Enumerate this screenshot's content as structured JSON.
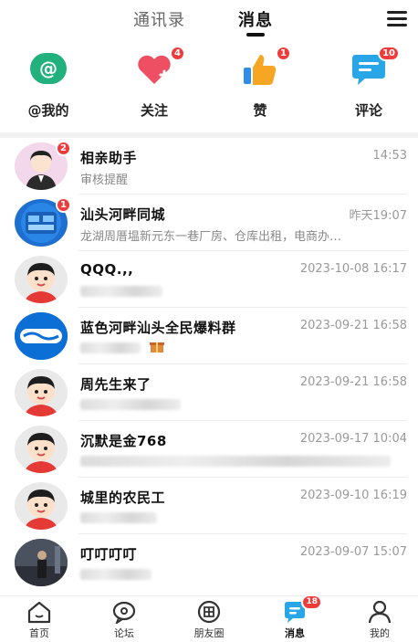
{
  "top_tabs": [
    {
      "label": "通讯录"
    },
    {
      "label": "消息"
    }
  ],
  "quick_actions": [
    {
      "label": "@我的",
      "icon": "at-icon",
      "badge": "",
      "color": "#22b07d"
    },
    {
      "label": "关注",
      "icon": "heart-plus-icon",
      "badge": "4",
      "color": "#ef4f63"
    },
    {
      "label": "赞",
      "icon": "thumbs-up-icon",
      "badge": "1",
      "color": "#f6a623"
    },
    {
      "label": "评论",
      "icon": "comment-icon",
      "badge": "10",
      "color": "#29a6e8"
    }
  ],
  "conversations": [
    {
      "name": "相亲助手",
      "time": "14:53",
      "preview": "审核提醒",
      "badge": "2",
      "avatar": "cartoon-man-avatar"
    },
    {
      "name": "汕头河畔同城",
      "time": "昨天19:07",
      "preview": "龙湖周厝塭新元东一巷厂房、仓库出租，电商办…",
      "badge": "1",
      "avatar": "blue-logo-avatar"
    },
    {
      "name": "QQQ.,,",
      "time": "2023-10-08 16:17",
      "preview": "",
      "badge": "",
      "avatar": "default-user-avatar"
    },
    {
      "name": "蓝色河畔汕头全民爆料群",
      "time": "2023-09-21 16:58",
      "preview": "",
      "badge": "",
      "avatar": "blue-river-logo-avatar"
    },
    {
      "name": "周先生来了",
      "time": "2023-09-21 16:58",
      "preview": "",
      "badge": "",
      "avatar": "default-user-avatar"
    },
    {
      "name": "沉默是金768",
      "time": "2023-09-17 10:04",
      "preview": "",
      "badge": "",
      "avatar": "default-user-avatar"
    },
    {
      "name": "城里的农民工",
      "time": "2023-09-10 16:19",
      "preview": "",
      "badge": "",
      "avatar": "default-user-avatar"
    },
    {
      "name": "叮叮叮叮",
      "time": "2023-09-07 15:07",
      "preview": "",
      "badge": "",
      "avatar": "photo-avatar"
    }
  ],
  "bottom_nav": [
    {
      "label": "首页",
      "icon": "home-icon"
    },
    {
      "label": "论坛",
      "icon": "forum-icon"
    },
    {
      "label": "朋友圈",
      "icon": "moments-icon"
    },
    {
      "label": "消息",
      "icon": "message-icon",
      "badge": "18"
    },
    {
      "label": "我的",
      "icon": "profile-icon"
    }
  ]
}
